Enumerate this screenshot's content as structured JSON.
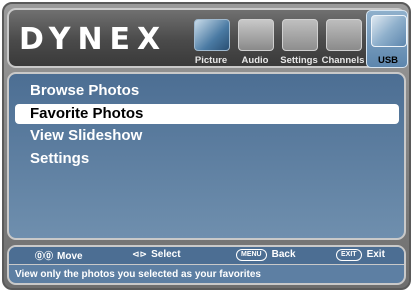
{
  "brand": {
    "logo_text": "DYNEX"
  },
  "tabs": [
    {
      "label": "Picture",
      "icon": "picture-icon",
      "active": false
    },
    {
      "label": "Audio",
      "icon": "audio-icon",
      "active": false
    },
    {
      "label": "Settings",
      "icon": "settings-icon",
      "active": false
    },
    {
      "label": "Channels",
      "icon": "channels-icon",
      "active": false
    },
    {
      "label": "USB",
      "icon": "usb-icon",
      "active": true
    }
  ],
  "menu": {
    "items": [
      {
        "label": "Browse Photos",
        "selected": false
      },
      {
        "label": "Favorite Photos",
        "selected": true
      },
      {
        "label": "View Slideshow",
        "selected": false
      },
      {
        "label": "Settings",
        "selected": false
      }
    ]
  },
  "footer": {
    "hints": {
      "move": {
        "glyph": "⓪⓪",
        "label": "Move"
      },
      "select": {
        "glyph": "⊲⊳",
        "label": "Select"
      },
      "back": {
        "key": "MENU",
        "label": "Back"
      },
      "exit": {
        "key": "EXIT",
        "label": "Exit"
      }
    },
    "description": "View only the photos you selected as your favorites"
  },
  "colors": {
    "frame": "#7a7a7a",
    "header": "#4a4a4a",
    "menu_bg": "#5d7fa3",
    "selected_bg": "#ffffff",
    "active_tab": "#7aa0c3"
  }
}
